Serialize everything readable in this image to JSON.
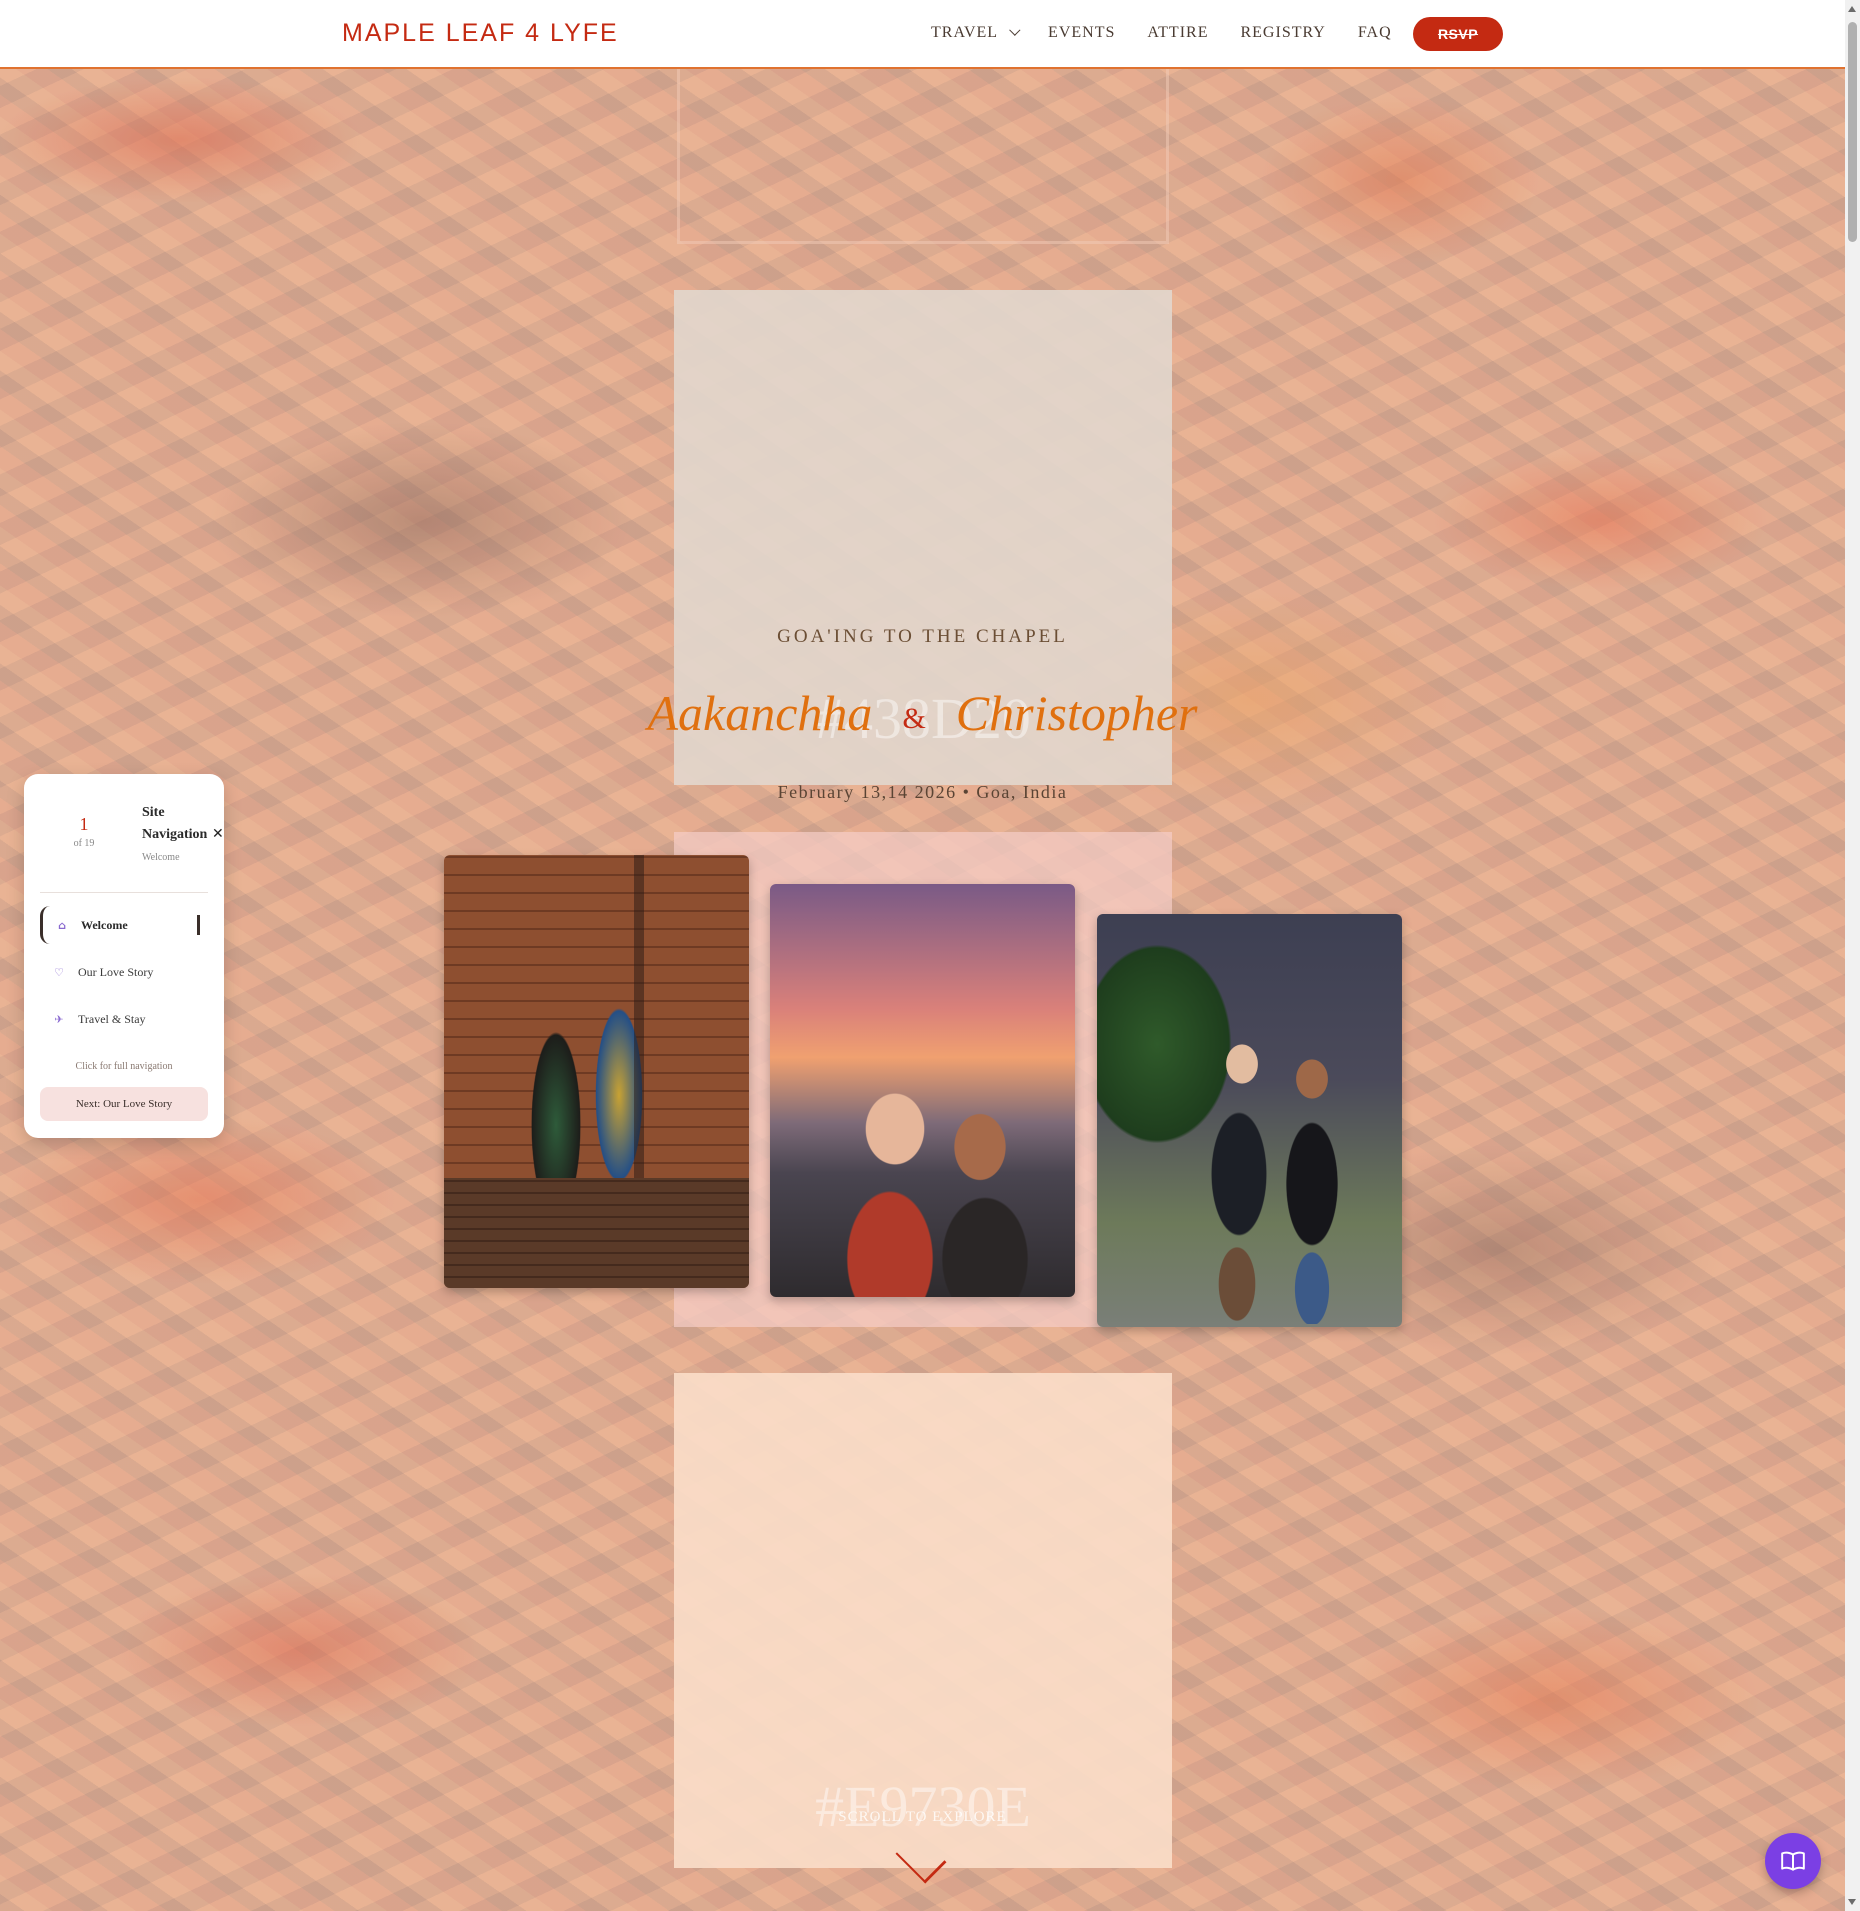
{
  "header": {
    "logo": "MAPLE LEAF 4 LYFE",
    "nav": [
      {
        "label": "TRAVEL",
        "has_dropdown": true
      },
      {
        "label": "EVENTS"
      },
      {
        "label": "ATTIRE"
      },
      {
        "label": "REGISTRY"
      },
      {
        "label": "FAQ"
      }
    ],
    "rsvp_label": "RSVP"
  },
  "swatches": {
    "hex_beige": "#438D20",
    "hex_peach": "#E9730E"
  },
  "hero": {
    "tagline": "GOA'ING TO THE CHAPEL",
    "name_1": "Aakanchha",
    "ampersand": "&",
    "name_2": "Christopher",
    "date_line": "February 13,14 2026 • Goa, India"
  },
  "photos": [
    {
      "icon": "couple-photo-brick-wall"
    },
    {
      "icon": "couple-selfie-sunset"
    },
    {
      "icon": "couple-photo-garden"
    }
  ],
  "scroll_hint": "SCROLL TO EXPLORE",
  "side_nav": {
    "current": "1",
    "total": "of 19",
    "title": "Site Navigation",
    "subtitle": "Welcome",
    "items": [
      {
        "label": "Welcome",
        "icon": "home-icon",
        "active": true
      },
      {
        "label": "Our Love Story",
        "icon": "heart-icon"
      },
      {
        "label": "Travel & Stay",
        "icon": "plane-icon"
      }
    ],
    "click_hint": "Click for full navigation",
    "next_label": "Next: Our Love Story"
  },
  "colors": {
    "accent_red": "#c42a12",
    "accent_orange": "#e0700f",
    "fab_purple": "#7b3fe4"
  }
}
